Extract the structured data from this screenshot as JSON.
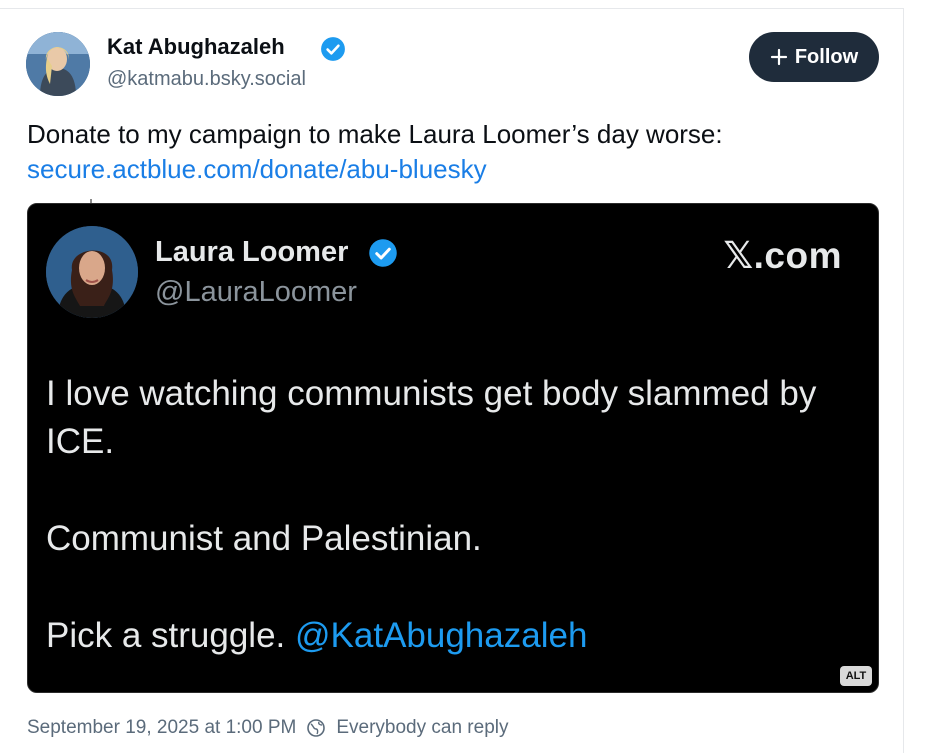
{
  "author": {
    "name": "Kat Abughazaleh",
    "handle": "@katmabu.bsky.social",
    "verified_icon": "verified-badge-icon"
  },
  "follow": {
    "label": "Follow",
    "icon": "plus-icon"
  },
  "post": {
    "text": "Donate to my campaign to make Laura Loomer’s day worse:",
    "link": "secure.actblue.com/donate/abu-bluesky"
  },
  "embed": {
    "name": "Laura Loomer",
    "handle": "@LauraLoomer",
    "source": "𝕏.com",
    "line1": "I love watching communists get body slammed by",
    "line2": "ICE.",
    "line3": "Communist and Palestinian.",
    "line4_text": "Pick a struggle. ",
    "line4_mention": "@KatAbughazaleh",
    "alt": "ALT"
  },
  "meta": {
    "timestamp": "September 19, 2025 at 1:00 PM",
    "reply_setting": "Everybody can reply",
    "reply_icon": "globe-icon"
  },
  "colors": {
    "link": "#1a7ee6",
    "follow_bg": "#1f2c3b",
    "verified": "#1d9bf0",
    "mention": "#1d9bf0"
  }
}
